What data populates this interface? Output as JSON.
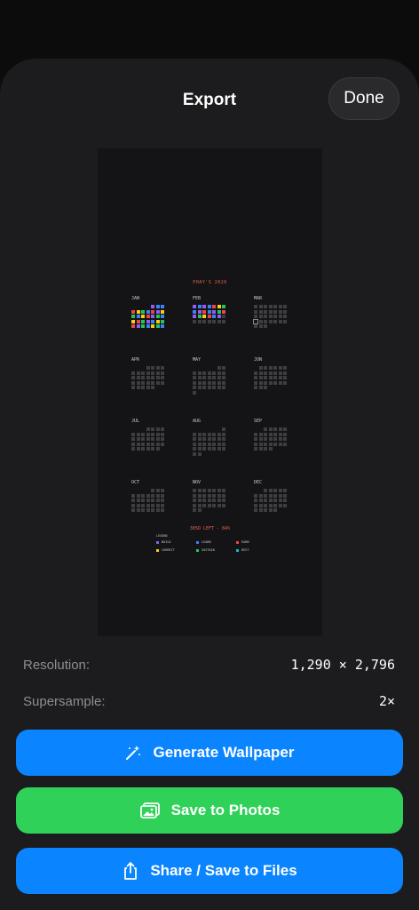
{
  "sheet": {
    "title": "Export",
    "done_label": "Done"
  },
  "preview": {
    "title": "PHAY'S 2026",
    "days_left": "305D LEFT - 84%",
    "months": [
      {
        "label": "JAN",
        "offset": 4,
        "days": 31,
        "colors": [
          "#8e5cf7",
          "#3b82f6",
          "#3b82f6",
          "#ef4444",
          "#facc15",
          "#22c55e",
          "#3b82f6",
          "#ef4444",
          "#8e5cf7",
          "#facc15",
          "#22c55e",
          "#3b82f6",
          "#facc15",
          "#ef4444",
          "#8e5cf7",
          "#22c55e",
          "#3b82f6",
          "#facc15",
          "#ef4444",
          "#22c55e",
          "#8e5cf7",
          "#3b82f6",
          "#facc15",
          "#22c55e",
          "#ef4444",
          "#8e5cf7",
          "#22c55e",
          "#3b82f6",
          "#facc15",
          "#22c55e",
          "#3b82f6"
        ]
      },
      {
        "label": "FEB",
        "offset": 0,
        "days": 28,
        "colors": [
          "#8e5cf7",
          "#3b82f6",
          "#8e5cf7",
          "#3b82f6",
          "#ef4444",
          "#facc15",
          "#22c55e",
          "#3b82f6",
          "#8e5cf7",
          "#ef4444",
          "#3b82f6",
          "#8e5cf7",
          "#22c55e",
          "#ef4444",
          "#8e5cf7",
          "#22c55e",
          "#facc15",
          "#ef4444",
          "#3b82f6",
          "#8e5cf7"
        ]
      },
      {
        "label": "MAR",
        "offset": 0,
        "days": 31,
        "today": 21
      },
      {
        "label": "APR",
        "offset": 3,
        "days": 30
      },
      {
        "label": "MAY",
        "offset": 5,
        "days": 31
      },
      {
        "label": "JUN",
        "offset": 1,
        "days": 30
      },
      {
        "label": "JUL",
        "offset": 3,
        "days": 31
      },
      {
        "label": "AUG",
        "offset": 6,
        "days": 31
      },
      {
        "label": "SEP",
        "offset": 2,
        "days": 30
      },
      {
        "label": "OCT",
        "offset": 4,
        "days": 31
      },
      {
        "label": "NOV",
        "offset": 0,
        "days": 30
      },
      {
        "label": "DEC",
        "offset": 2,
        "days": 31
      }
    ],
    "legend": {
      "title": "LEGEND",
      "items": [
        {
          "label": "BUILD",
          "color": "#8e5cf7"
        },
        {
          "label": "LEARN",
          "color": "#3b82f6"
        },
        {
          "label": "EARN",
          "color": "#ef4444"
        },
        {
          "label": "CORRECT",
          "color": "#facc15"
        },
        {
          "label": "SUSTAIN",
          "color": "#22c55e"
        },
        {
          "label": "REST",
          "color": "#14b8c8"
        }
      ]
    }
  },
  "info": {
    "resolution_label": "Resolution:",
    "resolution_value": "1,290 × 2,796",
    "supersample_label": "Supersample:",
    "supersample_value": "2×"
  },
  "actions": {
    "generate_label": "Generate Wallpaper",
    "photos_label": "Save to Photos",
    "share_label": "Share / Save to Files"
  },
  "colors": {
    "blue": "#0a84ff",
    "green": "#30d158"
  }
}
